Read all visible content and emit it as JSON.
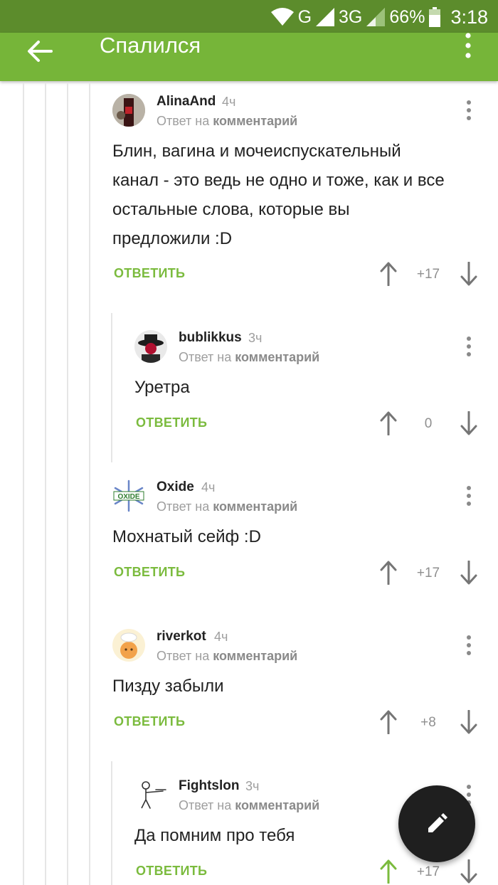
{
  "status_bar": {
    "network_1": "G",
    "network_2": "3G",
    "battery": "66%",
    "time": "3:18"
  },
  "app_bar": {
    "title": "Спалился",
    "back_icon": "arrow-left-icon",
    "menu_icon": "more-vertical-icon"
  },
  "reply_to_prefix": "Ответ на",
  "reply_to_link": "комментарий",
  "reply_label": "ОТВЕТИТЬ",
  "comments": [
    {
      "username": "AlinaAnd",
      "age": "4ч",
      "text": "Блин, вагина и мочеиспускательный канал - это ведь не одно и тоже, как и все остальные слова, которые вы предложили :D",
      "score": "+17"
    },
    {
      "username": "bublikkus",
      "age": "3ч",
      "text": "Уретра",
      "score": "0"
    },
    {
      "username": "Oxide",
      "age": "4ч",
      "text": "Мохнатый сейф :D",
      "score": "+17",
      "avatar_text": "OXIDE"
    },
    {
      "username": "riverkot",
      "age": "4ч",
      "text": "Пизду забыли",
      "score": "+8"
    },
    {
      "username": "Fightslon",
      "age": "3ч",
      "text": "Да помним про тебя",
      "score": "+17",
      "upvoted": true
    }
  ],
  "colors": {
    "status_bar": "#5c8c2c",
    "app_bar": "#76b539",
    "accent_green": "#7bbb3e",
    "fab": "#1f1f1f"
  },
  "fab_icon": "pencil-icon"
}
